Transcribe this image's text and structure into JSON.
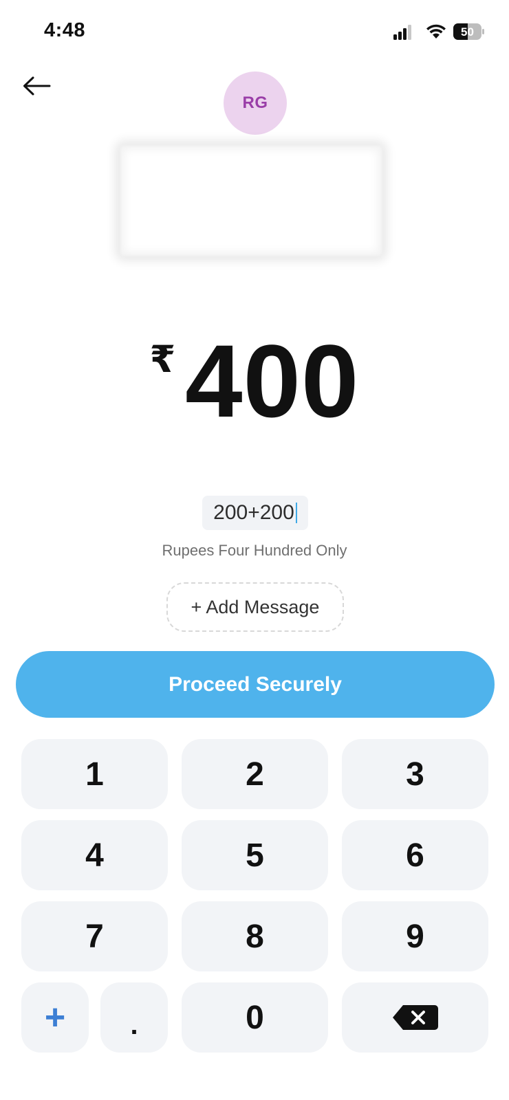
{
  "status_bar": {
    "time": "4:48",
    "battery": "50"
  },
  "recipient": {
    "initials": "RG"
  },
  "amount": {
    "currency_symbol": "₹",
    "value": "400"
  },
  "expression": "200+200",
  "amount_in_words": "Rupees Four Hundred Only",
  "add_message_label": "+ Add Message",
  "proceed_label": "Proceed Securely",
  "keypad": {
    "k1": "1",
    "k2": "2",
    "k3": "3",
    "k4": "4",
    "k5": "5",
    "k6": "6",
    "k7": "7",
    "k8": "8",
    "k9": "9",
    "plus": "+",
    "dot": ".",
    "k0": "0"
  },
  "colors": {
    "accent": "#4fb3ec",
    "avatar_bg": "#ecd3ee",
    "avatar_text": "#9a3ea8",
    "plus_key": "#3d7fd4",
    "key_bg": "#f2f4f7"
  }
}
